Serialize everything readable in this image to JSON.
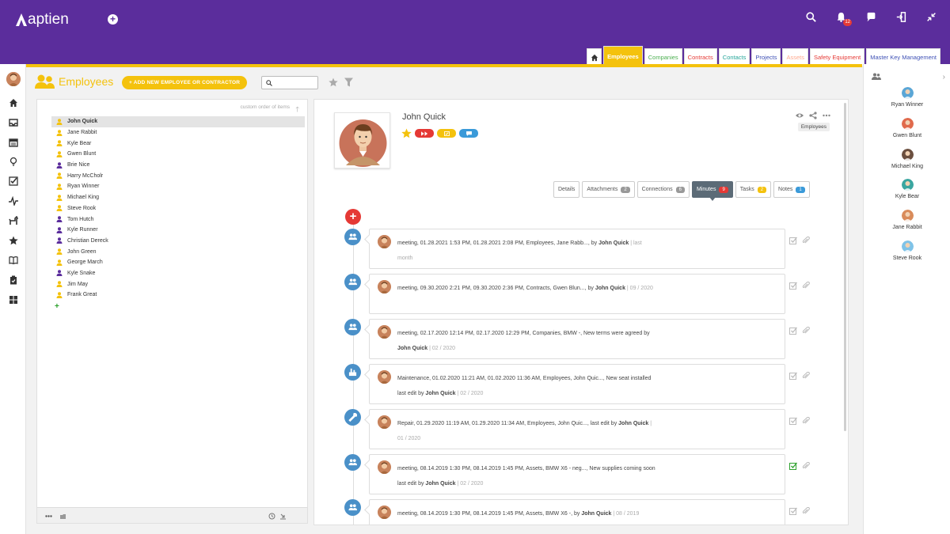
{
  "app": {
    "name": "aptien"
  },
  "colors": {
    "brand": "#5b2d9c",
    "accent": "#f4c20d",
    "danger": "#e53935",
    "info": "#3a9ad9"
  },
  "topbar": {
    "icons": [
      "search-icon",
      "bell-icon",
      "chat-icon",
      "logout-icon",
      "collapse-icon"
    ],
    "notifications_count": "12"
  },
  "module_tabs": [
    {
      "label": "Employees",
      "color": "#f4c20d",
      "active": true
    },
    {
      "label": "Companies",
      "color": "#4caf50"
    },
    {
      "label": "Contracts",
      "color": "#e53935"
    },
    {
      "label": "Contacts",
      "color": "#26a69a"
    },
    {
      "label": "Projects",
      "color": "#3f51b5"
    },
    {
      "label": "Assets",
      "color": "#ffab91"
    },
    {
      "label": "Safety Equipment",
      "color": "#e53935"
    },
    {
      "label": "Master Key Management",
      "color": "#3f51b5"
    }
  ],
  "page": {
    "title": "Employees",
    "add_button": "+ ADD NEW EMPLOYEE OR CONTRACTOR",
    "search": {
      "value": "",
      "placeholder": ""
    }
  },
  "employee_list": {
    "sort_label": "custom order of items",
    "items": [
      {
        "name": "John Quick",
        "icon_color": "#f4c20d",
        "selected": true
      },
      {
        "name": "Jane Rabbit",
        "icon_color": "#f4c20d"
      },
      {
        "name": "Kyle Bear",
        "icon_color": "#f4c20d"
      },
      {
        "name": "Gwen Blunt",
        "icon_color": "#f4c20d"
      },
      {
        "name": "Brie Nice",
        "icon_color": "#5b2d9c"
      },
      {
        "name": "Harry McCholr",
        "icon_color": "#f4c20d"
      },
      {
        "name": "Ryan Winner",
        "icon_color": "#f4c20d"
      },
      {
        "name": "Michael King",
        "icon_color": "#f4c20d"
      },
      {
        "name": "Steve Rook",
        "icon_color": "#f4c20d"
      },
      {
        "name": "Tom Hutch",
        "icon_color": "#5b2d9c"
      },
      {
        "name": "Kyle Runner",
        "icon_color": "#5b2d9c"
      },
      {
        "name": "Christian Dereck",
        "icon_color": "#5b2d9c"
      },
      {
        "name": "John Green",
        "icon_color": "#f4c20d"
      },
      {
        "name": "George March",
        "icon_color": "#f4c20d"
      },
      {
        "name": "Kyle Snake",
        "icon_color": "#5b2d9c"
      },
      {
        "name": "Jim May",
        "icon_color": "#f4c20d"
      },
      {
        "name": "Frank Great",
        "icon_color": "#f4c20d"
      }
    ],
    "add_label": "+"
  },
  "detail": {
    "name": "John Quick",
    "tag": "Employees",
    "tabs": [
      {
        "label": "Details",
        "count": ""
      },
      {
        "label": "Attachments",
        "count": "2"
      },
      {
        "label": "Connections",
        "count": "6"
      },
      {
        "label": "Minutes",
        "count": "9",
        "active": true
      },
      {
        "label": "Tasks",
        "count": "2"
      },
      {
        "label": "Notes",
        "count": "1"
      }
    ],
    "minutes": [
      {
        "icon": "meeting-icon",
        "text": "meeting, 01.28.2021 1:53 PM, 01.28.2021 2:08 PM, Employees, Jane Rabb...,",
        "edit": " by ",
        "author": "John Quick",
        "date": " | last month",
        "done": false
      },
      {
        "icon": "meeting-icon",
        "text": "meeting, 09.30.2020 2:21 PM, 09.30.2020 2:36 PM, Contracts, Gwen Blun...,",
        "edit": " by ",
        "author": "John Quick",
        "date": " | 09 / 2020",
        "done": false
      },
      {
        "icon": "meeting-icon",
        "text": "meeting, 02.17.2020 12:14 PM, 02.17.2020 12:29 PM, Companies, BMW -, New terms were agreed",
        "edit": " by ",
        "author": "John Quick",
        "date": " | 02 / 2020",
        "done": false
      },
      {
        "icon": "maintenance-icon",
        "text": "Maintenance, 01.02.2020 11:21 AM, 01.02.2020 11:36 AM, Employees, John Quic..., New seat installed",
        "edit": " last edit by ",
        "author": "John Quick",
        "date": " | 02 / 2020",
        "done": false
      },
      {
        "icon": "wrench-icon",
        "text": "Repair, 01.29.2020 11:19 AM, 01.29.2020 11:34 AM, Employees, John Quic...,",
        "edit": " last edit by ",
        "author": "John Quick",
        "date": " | 01 / 2020",
        "done": false
      },
      {
        "icon": "meeting-icon",
        "text": "meeting, 08.14.2019 1:30 PM, 08.14.2019 1:45 PM, Assets, BMW X6 - neg..., New supplies coming soon",
        "edit": " last edit by ",
        "author": "John Quick",
        "date": " | 02 / 2020",
        "done": true
      },
      {
        "icon": "meeting-icon",
        "text": "meeting, 08.14.2019 1:30 PM, 08.14.2019 1:45 PM, Assets, BMW X6 -,",
        "edit": " by ",
        "author": "John Quick",
        "date": " | 08 / 2019",
        "done": false
      }
    ]
  },
  "people": [
    {
      "name": "Ryan Winner",
      "color": "#5aa6d6"
    },
    {
      "name": "Gwen Blunt",
      "color": "#e06a4c"
    },
    {
      "name": "Michael King",
      "color": "#6b4f3f"
    },
    {
      "name": "Kyle Bear",
      "color": "#3aa6a0"
    },
    {
      "name": "Jane Rabbit",
      "color": "#d98b5a"
    },
    {
      "name": "Steve Rook",
      "color": "#7fc3e8"
    }
  ]
}
